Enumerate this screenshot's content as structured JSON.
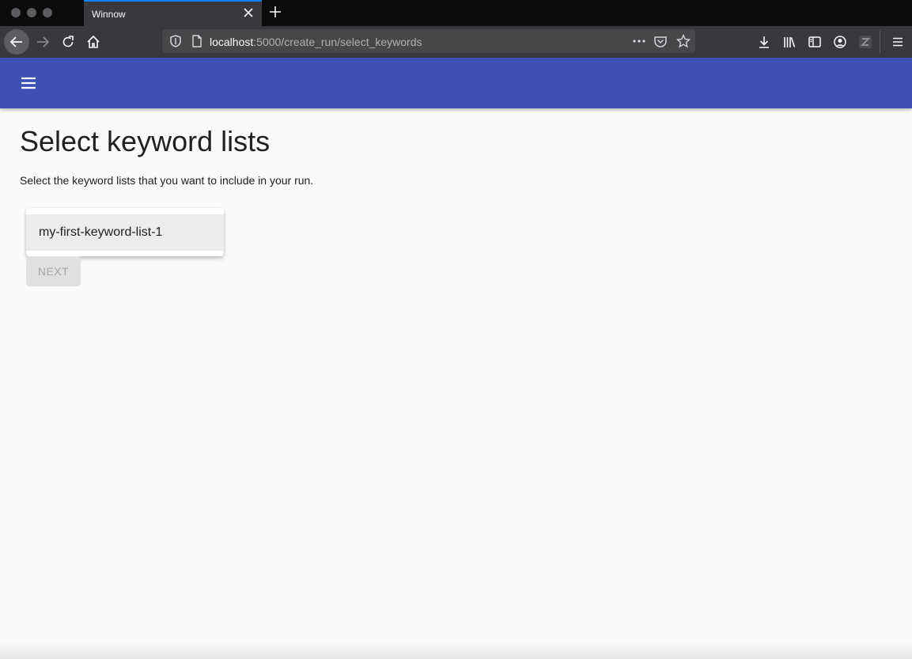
{
  "browser": {
    "tab_title": "Winnow",
    "url_host": "localhost",
    "url_rest": ":5000/create_run/select_keywords"
  },
  "colors": {
    "app_bar": "#3f51b5",
    "accent_tab": "#0a84ff"
  },
  "icons": {
    "menu": "hamburger-menu-icon",
    "back": "arrow-left-icon",
    "forward": "arrow-right-icon",
    "reload": "reload-icon",
    "home": "home-icon"
  },
  "page": {
    "title": "Select keyword lists",
    "description": "Select the keyword lists that you want to include in your run.",
    "keyword_lists": [
      "my-first-keyword-list-1"
    ],
    "next_label": "NEXT"
  }
}
